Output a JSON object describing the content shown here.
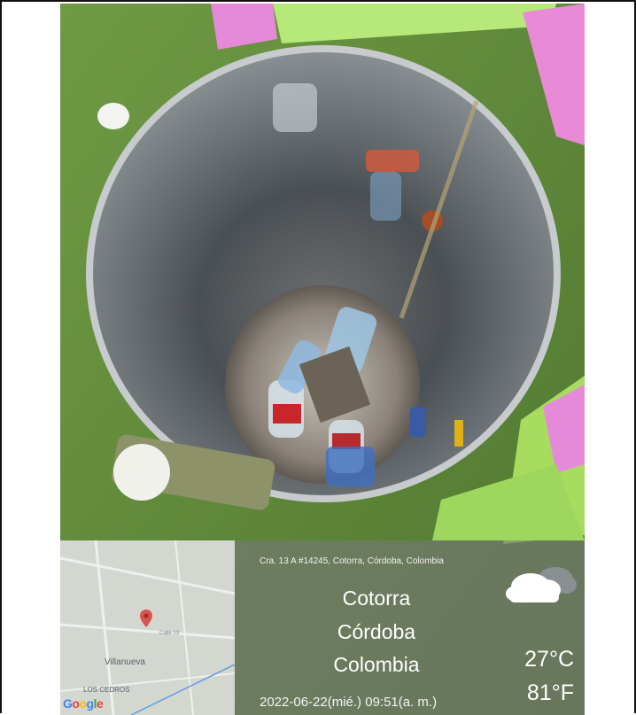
{
  "photo": {
    "description_icon": "trash-can-photo",
    "palette": {
      "grass": "#5f8a3c",
      "pink_tile": "#e58ad8",
      "green_tile": "#a8e06a",
      "metal": "#8d9497",
      "metal_dark": "#3d4246"
    }
  },
  "map": {
    "labels": {
      "area": "Villanueva",
      "street": "Calle 13",
      "neighborhood": "LOS CEDROS",
      "brand": "Google"
    },
    "pin_icon": "map-pin-icon",
    "pin_color": "#d9534f"
  },
  "info": {
    "address": "Cra. 13 A #14245, Cotorra, Córdoba, Colombia",
    "city": "Cotorra",
    "region": "Córdoba",
    "country": "Colombia",
    "datetime": "2022-06-22(mié.)  09:51(a. m.)",
    "temp_c": "27°C",
    "temp_f": "81°F",
    "weather_icon": "cloudy-weather-icon"
  }
}
